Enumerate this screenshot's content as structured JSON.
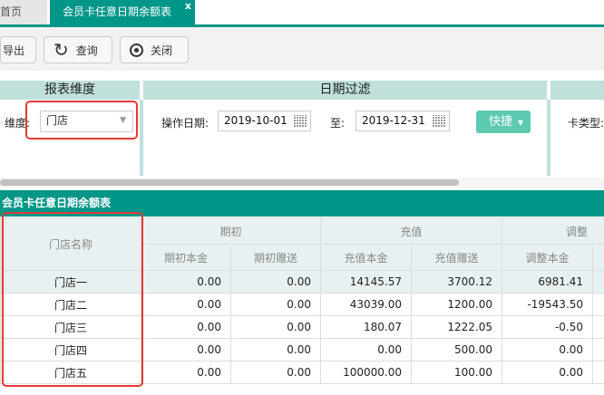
{
  "tabs": [
    {
      "label": "首页"
    },
    {
      "label": "会员卡任意日期余额表",
      "close": "x"
    }
  ],
  "toolbar": {
    "export": "导出",
    "query": "查询",
    "close": "关闭"
  },
  "panels": {
    "dimension": {
      "title": "报表维度",
      "label": "维度:",
      "value": "门店"
    },
    "date": {
      "title": "日期过滤",
      "op_label": "操作日期:",
      "start": "2019-10-01",
      "to_label": "至:",
      "end": "2019-12-31",
      "quick": "快捷"
    },
    "card": {
      "label": "卡类型:"
    }
  },
  "table": {
    "title": "会员卡任意日期余额表",
    "name_header": "门店名称",
    "groups": [
      "期初",
      "充值",
      "调整"
    ],
    "columns": [
      "期初本金",
      "期初赠送",
      "充值本金",
      "充值赠送",
      "调整本金"
    ],
    "rows": [
      {
        "name": "门店一",
        "values": [
          "0.00",
          "0.00",
          "14145.57",
          "3700.12",
          "6981.41"
        ]
      },
      {
        "name": "门店二",
        "values": [
          "0.00",
          "0.00",
          "43039.00",
          "1200.00",
          "-19543.50"
        ]
      },
      {
        "name": "门店三",
        "values": [
          "0.00",
          "0.00",
          "180.07",
          "1222.05",
          "-0.50"
        ]
      },
      {
        "name": "门店四",
        "values": [
          "0.00",
          "0.00",
          "0.00",
          "500.00",
          "0.00"
        ]
      },
      {
        "name": "门店五",
        "values": [
          "0.00",
          "0.00",
          "100000.00",
          "100.00",
          "0.00"
        ]
      }
    ]
  },
  "colors": {
    "accent": "#009688",
    "panel_header": "#c0e0dc",
    "highlight": "#e53935"
  }
}
